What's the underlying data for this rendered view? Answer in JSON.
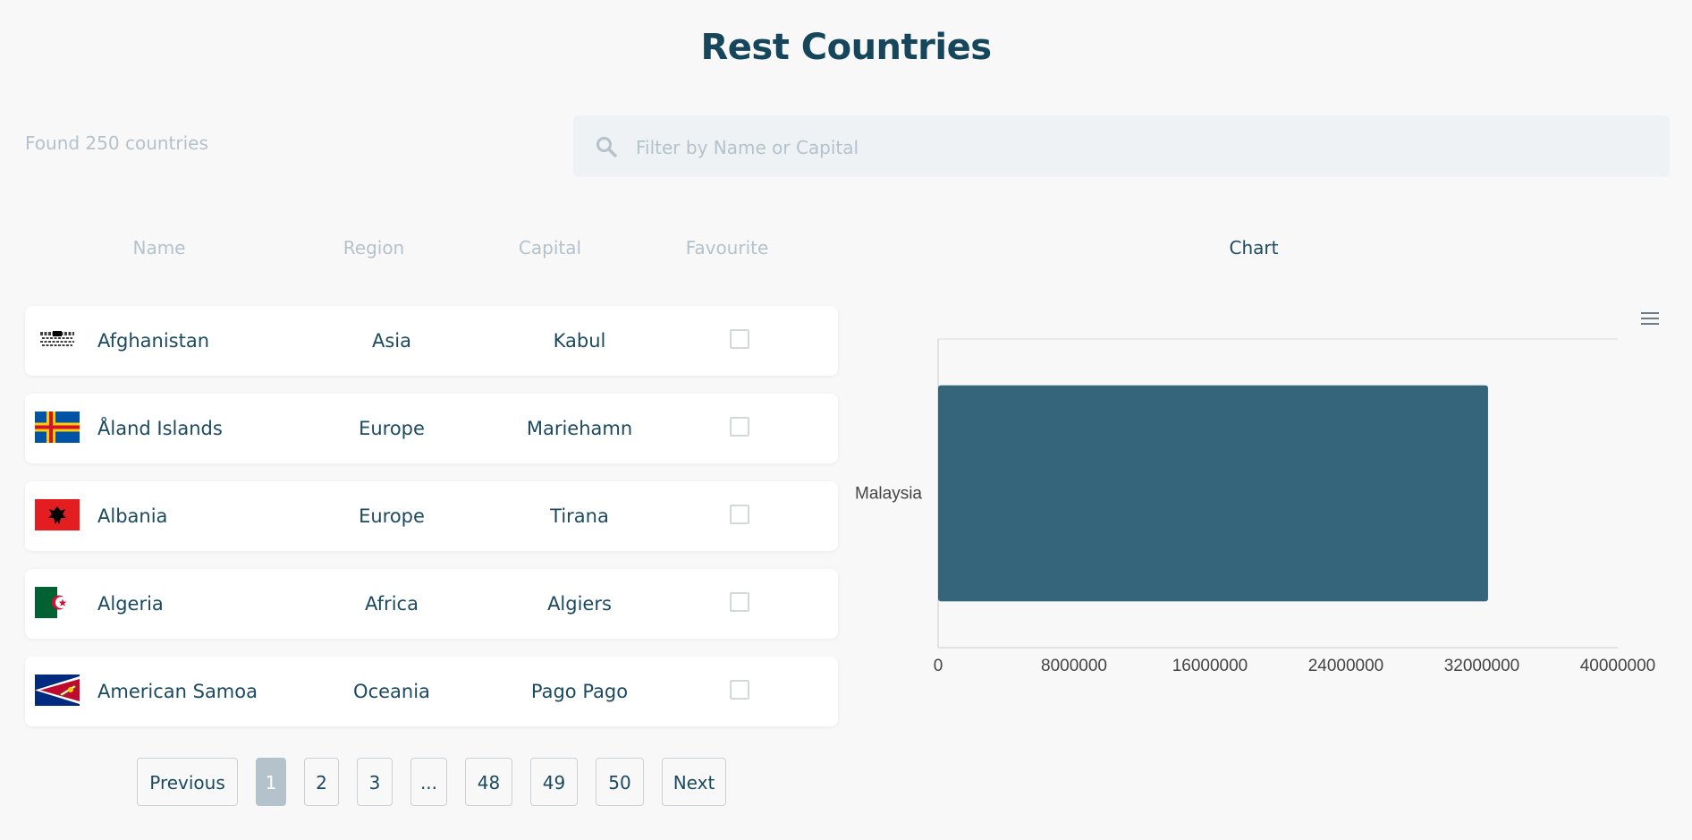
{
  "app": {
    "title": "Rest Countries"
  },
  "filter": {
    "found_text": "Found 250 countries",
    "placeholder": "Filter by Name or Capital",
    "value": ""
  },
  "table": {
    "headers": {
      "name": "Name",
      "region": "Region",
      "capital": "Capital",
      "favourite": "Favourite"
    },
    "rows": [
      {
        "flag": "afghanistan-flag",
        "name": "Afghanistan",
        "region": "Asia",
        "capital": "Kabul",
        "favourite": false
      },
      {
        "flag": "aland-flag",
        "name": "Åland Islands",
        "region": "Europe",
        "capital": "Mariehamn",
        "favourite": false
      },
      {
        "flag": "albania-flag",
        "name": "Albania",
        "region": "Europe",
        "capital": "Tirana",
        "favourite": false
      },
      {
        "flag": "algeria-flag",
        "name": "Algeria",
        "region": "Africa",
        "capital": "Algiers",
        "favourite": false
      },
      {
        "flag": "american-samoa-flag",
        "name": "American Samoa",
        "region": "Oceania",
        "capital": "Pago Pago",
        "favourite": false
      }
    ]
  },
  "pagination": {
    "previous": "Previous",
    "pages": [
      "1",
      "2",
      "3",
      "...",
      "48",
      "49",
      "50"
    ],
    "active": "1",
    "next": "Next"
  },
  "chart_panel": {
    "heading": "Chart",
    "menu_icon": "hamburger-menu-icon"
  },
  "chart_data": {
    "type": "bar",
    "orientation": "horizontal",
    "categories": [
      "Malaysia"
    ],
    "values": [
      32365999
    ],
    "xlim": [
      0,
      40000000
    ],
    "xticks": [
      "0",
      "8000000",
      "16000000",
      "24000000",
      "32000000",
      "40000000"
    ],
    "bar_color": "#35657a",
    "grid": false
  },
  "colors": {
    "primary": "#15465c",
    "muted": "#b3c2cb",
    "bar": "#35657a",
    "background": "#f8f8f8"
  }
}
